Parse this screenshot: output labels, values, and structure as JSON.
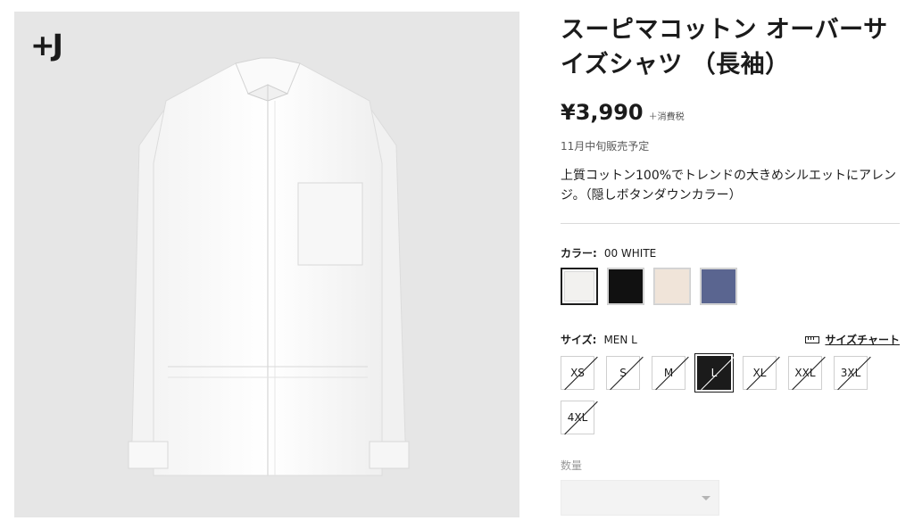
{
  "brand": {
    "logo_text": "+J"
  },
  "product": {
    "title": "スーピマコットン オーバーサイズシャツ （長袖）",
    "price": "¥3,990",
    "tax_note": "＋消費税",
    "release": "11月中旬販売予定",
    "description": "上質コットン100%でトレンドの大きめシルエットにアレンジ。（隠しボタンダウンカラー）"
  },
  "color": {
    "label": "カラー:",
    "selected": "00 WHITE",
    "swatches": [
      {
        "name": "white",
        "hex": "#f2f1ef",
        "selected": true
      },
      {
        "name": "black",
        "hex": "#111111",
        "selected": false
      },
      {
        "name": "natural",
        "hex": "#f0e4d9",
        "selected": false
      },
      {
        "name": "blue",
        "hex": "#5a6590",
        "selected": false
      }
    ]
  },
  "size": {
    "label": "サイズ:",
    "selected": "MEN L",
    "chart_label": "サイズチャート",
    "options": [
      {
        "label": "XS",
        "selected": false
      },
      {
        "label": "S",
        "selected": false
      },
      {
        "label": "M",
        "selected": false
      },
      {
        "label": "L",
        "selected": true
      },
      {
        "label": "XL",
        "selected": false
      },
      {
        "label": "XXL",
        "selected": false
      },
      {
        "label": "3XL",
        "selected": false
      },
      {
        "label": "4XL",
        "selected": false
      }
    ]
  },
  "quantity": {
    "label": "数量",
    "value": ""
  },
  "colors": {
    "text": "#1b1b1b",
    "image_bg": "#e6e6e6",
    "select_bg": "#f3f3f3"
  }
}
